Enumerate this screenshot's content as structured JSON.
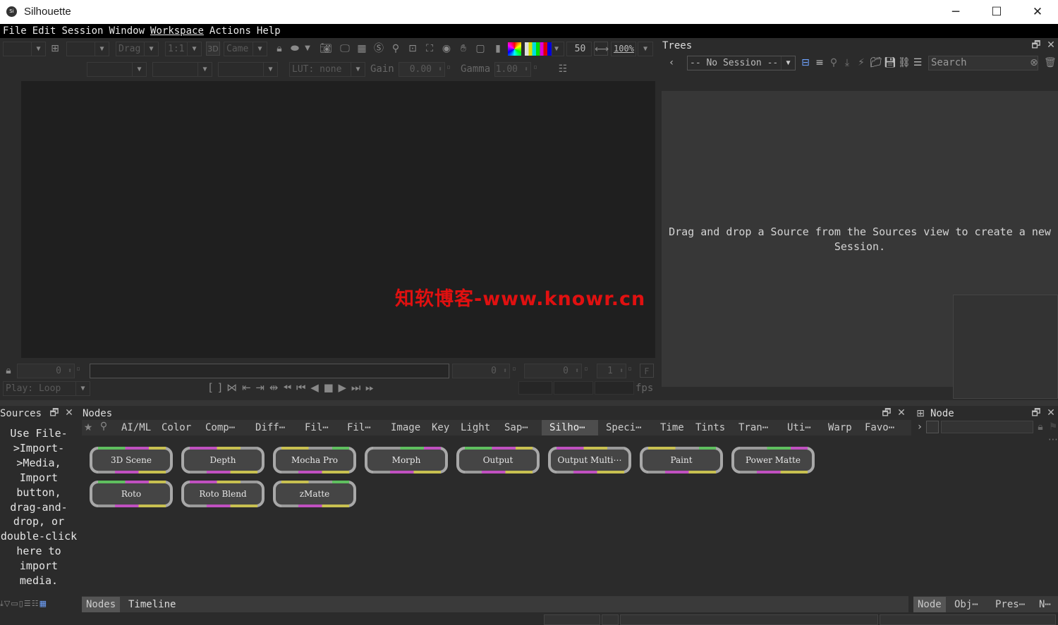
{
  "window": {
    "title": "Silhouette",
    "icon": "Si",
    "min": "─",
    "max": "☐",
    "close": "✕"
  },
  "menu": [
    "File",
    "Edit",
    "Session",
    "Window",
    "Workspace",
    "Actions",
    "Help"
  ],
  "viewer": {
    "drag_mode": "Drag",
    "zoom_ratio": "1:1",
    "label_3d": "3D",
    "camera": "Came",
    "frame_step": "50",
    "zoom_percent": "100%",
    "lut": "LUT: none",
    "gain_label": "Gain",
    "gain_value": "0.00",
    "gamma_label": "Gamma",
    "gamma_value": "1.00",
    "frame_in": "0",
    "frame_cur": "0",
    "frame_out": "0",
    "step": "1",
    "f_label": "F",
    "play_mode": "Play: Loop",
    "fps_label": "fps"
  },
  "trees": {
    "title": "Trees",
    "session": "-- No Session --",
    "search_placeholder": "Search",
    "empty_msg_1": "Drag and drop a Source from the Sources view to create a new",
    "empty_msg_2": "Session."
  },
  "sources": {
    "title": "Sources",
    "help": [
      "Use File-",
      ">Import-",
      ">Media,",
      "Import",
      "button,",
      "drag-and-",
      "drop, or",
      "double-click",
      "here to",
      "import",
      "media."
    ]
  },
  "nodes": {
    "title": "Nodes",
    "categories": [
      "AI/ML",
      "Color",
      "Comp⋯",
      "Diff⋯",
      "Fil⋯",
      "Fil⋯",
      "Image",
      "Key",
      "Light",
      "Sap⋯",
      "Silho⋯",
      "Speci⋯",
      "Time",
      "Tints",
      "Tran⋯",
      "Uti⋯",
      "Warp",
      "Favo⋯"
    ],
    "active_category": "Silho⋯",
    "items": [
      "3D Scene",
      "Depth",
      "Mocha Pro",
      "Morph",
      "Output",
      "Output Multi⋯",
      "Paint",
      "Power Matte",
      "Roto",
      "Roto Blend",
      "zMatte"
    ],
    "bottom_tabs": [
      "Nodes",
      "Timeline"
    ]
  },
  "node_panel": {
    "title": "Node",
    "tabs": [
      "Node",
      "Obj⋯",
      "Pres⋯",
      "N⋯"
    ]
  },
  "watermark": "知软博客-www.knowr.cn",
  "colors": {
    "bg": "#2b2b2b",
    "canvas": "#1f1f1f",
    "active_tab": "#4d4d4d",
    "watermark": "#e01010"
  }
}
